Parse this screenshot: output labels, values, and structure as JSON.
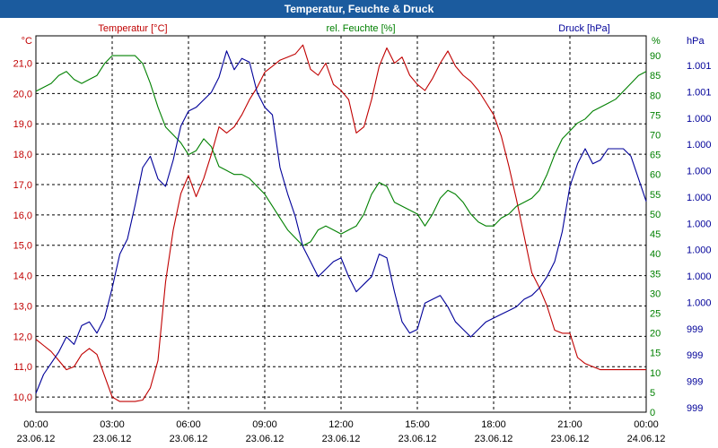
{
  "window": {
    "title": "Temperatur, Feuchte & Druck"
  },
  "colors": {
    "temperature": "#c00000",
    "humidity": "#008000",
    "pressure": "#000099",
    "title_bar": "#1b5b9e",
    "grid": "#000000",
    "text": "#000000"
  },
  "chart_data": {
    "type": "line",
    "title": "Temperatur, Feuchte & Druck",
    "grid": true,
    "legend": "top",
    "x_axis": {
      "range": [
        "23.06.12 00:00",
        "24.06.12 00:00"
      ],
      "ticks": [
        {
          "time": "00:00",
          "date": "23.06.12"
        },
        {
          "time": "03:00",
          "date": "23.06.12"
        },
        {
          "time": "06:00",
          "date": "23.06.12"
        },
        {
          "time": "09:00",
          "date": "23.06.12"
        },
        {
          "time": "12:00",
          "date": "23.06.12"
        },
        {
          "time": "15:00",
          "date": "23.06.12"
        },
        {
          "time": "18:00",
          "date": "23.06.12"
        },
        {
          "time": "21:00",
          "date": "23.06.12"
        },
        {
          "time": "00:00",
          "date": "24.06.12"
        }
      ]
    },
    "axes": {
      "temperature": {
        "label": "Temperatur [°C]",
        "unit": "°C",
        "range": [
          9.5,
          21.9
        ],
        "tick_values": [
          10,
          11,
          12,
          13,
          14,
          15,
          16,
          17,
          18,
          19,
          20,
          21
        ],
        "tick_labels": [
          "10,0",
          "11,0",
          "12,0",
          "13,0",
          "14,0",
          "15,0",
          "16,0",
          "17,0",
          "18,0",
          "19,0",
          "20,0",
          "21,0"
        ]
      },
      "humidity": {
        "label": "rel. Feuchte [%]",
        "unit": "%",
        "range": [
          0,
          95
        ],
        "tick_values": [
          0,
          5,
          10,
          15,
          20,
          25,
          30,
          35,
          40,
          45,
          50,
          55,
          60,
          65,
          70,
          75,
          80,
          85,
          90
        ],
        "tick_labels": [
          "0",
          "5",
          "10",
          "15",
          "20",
          "25",
          "30",
          "35",
          "40",
          "45",
          "50",
          "55",
          "60",
          "65",
          "70",
          "75",
          "80",
          "85",
          "90"
        ]
      },
      "pressure": {
        "label": "Druck [hPa]",
        "unit": "hPa",
        "tick_labels": [
          "1.001",
          "1.001",
          "1.000",
          "1.000",
          "1.000",
          "1.000",
          "1.000",
          "1.000",
          "1.000",
          "1.000",
          "999",
          "999",
          "999",
          "999"
        ]
      }
    },
    "series": [
      {
        "name": "Temperatur [°C]",
        "axis": "temperature",
        "x": [
          0,
          0.3,
          0.6,
          0.9,
          1.2,
          1.5,
          1.8,
          2.1,
          2.4,
          2.7,
          3,
          3.3,
          3.6,
          3.9,
          4.2,
          4.5,
          4.8,
          5.1,
          5.4,
          5.7,
          6,
          6.3,
          6.6,
          6.9,
          7.2,
          7.5,
          7.8,
          8.1,
          8.4,
          8.7,
          9,
          9.3,
          9.6,
          9.9,
          10.2,
          10.5,
          10.8,
          11.1,
          11.4,
          11.7,
          12,
          12.3,
          12.6,
          12.9,
          13.2,
          13.5,
          13.8,
          14.1,
          14.4,
          14.7,
          15,
          15.3,
          15.6,
          15.9,
          16.2,
          16.5,
          16.8,
          17.1,
          17.4,
          17.7,
          18,
          18.3,
          18.6,
          18.9,
          19.2,
          19.5,
          19.8,
          20.1,
          20.4,
          20.7,
          21,
          21.3,
          21.6,
          21.9,
          22.2,
          22.5,
          22.8,
          23.1,
          23.4,
          23.7,
          24
        ],
        "y": [
          11.9,
          11.7,
          11.5,
          11.2,
          10.9,
          11.0,
          11.4,
          11.6,
          11.4,
          10.7,
          10.0,
          9.85,
          9.85,
          9.85,
          9.9,
          10.3,
          11.2,
          13.8,
          15.5,
          16.7,
          17.3,
          16.6,
          17.2,
          18.0,
          18.9,
          18.7,
          18.9,
          19.3,
          19.8,
          20.2,
          20.7,
          20.9,
          21.1,
          21.2,
          21.3,
          21.6,
          20.8,
          20.6,
          21.0,
          20.3,
          20.1,
          19.8,
          18.7,
          18.9,
          19.8,
          20.9,
          21.5,
          21.0,
          21.2,
          20.6,
          20.3,
          20.1,
          20.5,
          21.0,
          21.4,
          20.9,
          20.6,
          20.4,
          20.1,
          19.7,
          19.3,
          18.6,
          17.6,
          16.5,
          15.3,
          14.1,
          13.6,
          13.0,
          12.2,
          12.1,
          12.1,
          11.3,
          11.1,
          11.0,
          10.9,
          10.9,
          10.9,
          10.9,
          10.9,
          10.9,
          10.9
        ]
      },
      {
        "name": "rel. Feuchte [%]",
        "axis": "humidity",
        "x": [
          0,
          0.3,
          0.6,
          0.9,
          1.2,
          1.5,
          1.8,
          2.1,
          2.4,
          2.7,
          3,
          3.3,
          3.6,
          3.9,
          4.2,
          4.5,
          4.8,
          5.1,
          5.4,
          5.7,
          6,
          6.3,
          6.6,
          6.9,
          7.2,
          7.5,
          7.8,
          8.1,
          8.4,
          8.7,
          9,
          9.3,
          9.6,
          9.9,
          10.2,
          10.5,
          10.8,
          11.1,
          11.4,
          11.7,
          12,
          12.3,
          12.6,
          12.9,
          13.2,
          13.5,
          13.8,
          14.1,
          14.4,
          14.7,
          15,
          15.3,
          15.6,
          15.9,
          16.2,
          16.5,
          16.8,
          17.1,
          17.4,
          17.7,
          18,
          18.3,
          18.6,
          18.9,
          19.2,
          19.5,
          19.8,
          20.1,
          20.4,
          20.7,
          21,
          21.3,
          21.6,
          21.9,
          22.2,
          22.5,
          22.8,
          23.1,
          23.4,
          23.7,
          24
        ],
        "y": [
          81,
          82,
          83,
          85,
          86,
          84,
          83,
          84,
          85,
          88,
          90,
          90,
          90,
          90,
          88,
          83,
          77,
          72,
          70,
          68,
          65,
          66,
          69,
          67,
          62,
          61,
          60,
          60,
          59,
          57,
          55,
          52,
          49,
          46,
          44,
          42,
          43,
          46,
          47,
          46,
          45,
          46,
          47,
          50,
          55,
          58,
          57,
          53,
          52,
          51,
          50,
          47,
          50,
          54,
          56,
          55,
          53,
          50,
          48,
          47,
          47,
          49,
          50,
          52,
          53,
          54,
          56,
          60,
          65,
          69,
          71,
          73,
          74,
          76,
          77,
          78,
          79,
          81,
          83,
          85,
          86
        ]
      },
      {
        "name": "Druck [hPa]",
        "axis": "pressure",
        "x": [
          0,
          0.3,
          0.6,
          0.9,
          1.2,
          1.5,
          1.8,
          2.1,
          2.4,
          2.7,
          3,
          3.3,
          3.6,
          3.9,
          4.2,
          4.5,
          4.8,
          5.1,
          5.4,
          5.7,
          6,
          6.3,
          6.6,
          6.9,
          7.2,
          7.5,
          7.8,
          8.1,
          8.4,
          8.7,
          9,
          9.3,
          9.6,
          9.9,
          10.2,
          10.5,
          10.8,
          11.1,
          11.4,
          11.7,
          12,
          12.3,
          12.6,
          12.9,
          13.2,
          13.5,
          13.8,
          14.1,
          14.4,
          14.7,
          15,
          15.3,
          15.6,
          15.9,
          16.2,
          16.5,
          16.8,
          17.1,
          17.4,
          17.7,
          18,
          18.3,
          18.6,
          18.9,
          19.2,
          19.5,
          19.8,
          20.1,
          20.4,
          20.7,
          21,
          21.3,
          21.6,
          21.9,
          22.2,
          22.5,
          22.8,
          23.1,
          23.4,
          23.7,
          24
        ],
        "y": [
          5,
          10,
          13,
          16,
          20,
          18,
          23,
          24,
          21,
          25,
          33,
          42,
          46,
          55,
          65,
          68,
          62,
          60,
          67,
          76,
          80,
          81,
          83,
          85,
          89,
          96,
          91,
          94,
          93,
          85,
          81,
          79,
          65,
          58,
          52,
          44,
          40,
          36,
          38,
          40,
          41,
          36,
          32,
          34,
          36,
          42,
          41,
          32,
          24,
          21,
          22,
          29,
          30,
          31,
          28,
          24,
          22,
          20,
          22,
          24,
          25,
          26,
          27,
          28,
          30,
          31,
          33,
          36,
          40,
          48,
          60,
          66,
          70,
          66,
          67,
          70,
          70,
          70,
          68,
          62,
          56
        ]
      }
    ]
  }
}
